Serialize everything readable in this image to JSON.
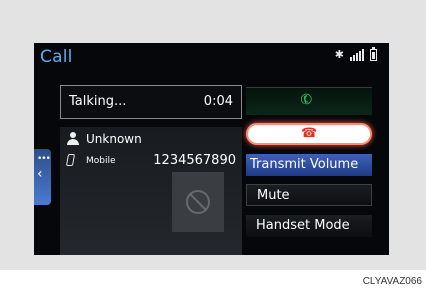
{
  "header": {
    "title": "Call"
  },
  "status_icons": [
    "bluetooth-icon",
    "signal-icon",
    "battery-icon"
  ],
  "call": {
    "status": "Talking...",
    "duration": "0:04"
  },
  "caller": {
    "name": "Unknown",
    "phone_type": "Mobile",
    "number": "1234567890"
  },
  "buttons": {
    "answer_icon": "phone-answer-icon",
    "hangup_icon": "phone-hangup-icon",
    "transmit_volume": "Transmit Volume",
    "mute": "Mute",
    "handset_mode": "Handset Mode"
  },
  "colors": {
    "title": "#58aef0",
    "answer": "#2fd46a",
    "hangup": "#e03020",
    "selected": "#3d62b8"
  },
  "caption": "CLYAVAZ066"
}
